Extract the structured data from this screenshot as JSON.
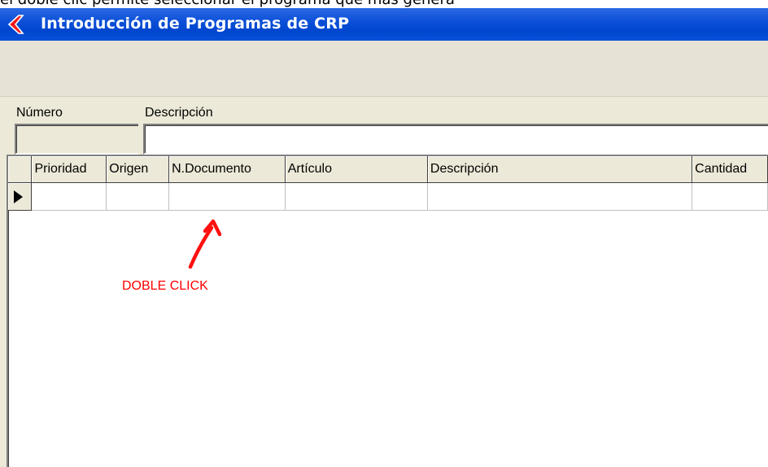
{
  "top_text": "el doble clic permite seleccionar el programa que mas genera",
  "window": {
    "title": "Introducción de Programas de CRP",
    "icon": "red-arrow-icon"
  },
  "form": {
    "numero_label": "Número",
    "numero_value": "",
    "descripcion_label": "Descripción",
    "descripcion_value": ""
  },
  "grid": {
    "columns": [
      "Prioridad",
      "Origen",
      "N.Documento",
      "Artículo",
      "Descripción",
      "Cantidad"
    ],
    "rows": [
      [
        "",
        "",
        "",
        "",
        "",
        ""
      ]
    ],
    "row_indicator_icon": "current-row-arrow-icon"
  },
  "annotation": {
    "text": "DOBLE CLICK",
    "color": "#ff0000",
    "icon": "hand-drawn-arrow-icon"
  },
  "colors": {
    "titlebar": "#0a4ed6",
    "window_bg": "#ece9d8",
    "annotation": "#ff0000"
  }
}
